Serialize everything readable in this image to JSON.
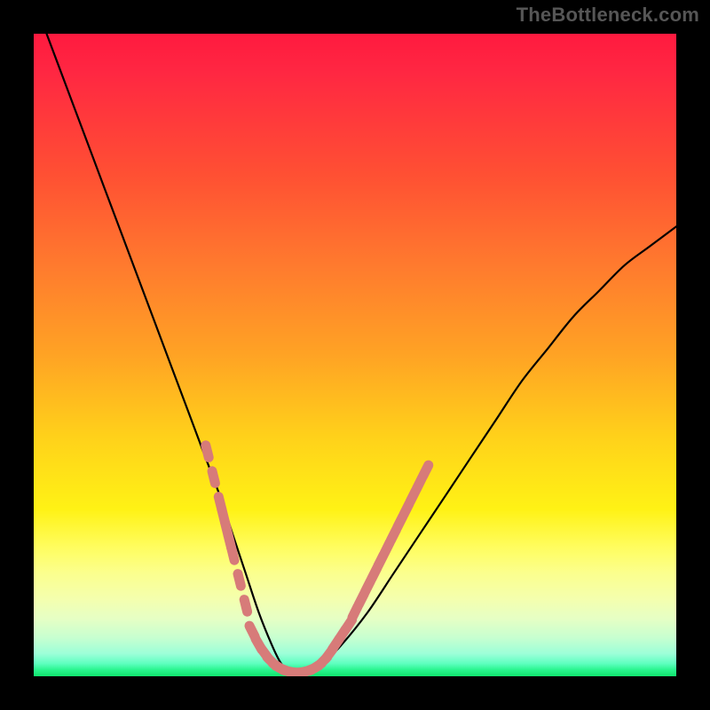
{
  "watermark": "TheBottleneck.com",
  "chart_data": {
    "type": "line",
    "title": "",
    "xlabel": "",
    "ylabel": "",
    "xlim": [
      0,
      100
    ],
    "ylim": [
      0,
      100
    ],
    "series": [
      {
        "name": "main-curve",
        "color": "#000000",
        "x": [
          2,
          5,
          8,
          11,
          14,
          17,
          20,
          23,
          26,
          29,
          31,
          33,
          35,
          37,
          38.5,
          40,
          42,
          45,
          48,
          52,
          56,
          60,
          64,
          68,
          72,
          76,
          80,
          84,
          88,
          92,
          96,
          100
        ],
        "y": [
          100,
          92,
          84,
          76,
          68,
          60,
          52,
          44,
          36,
          28,
          22,
          16,
          10,
          5,
          2,
          0.5,
          0.5,
          2,
          5,
          10,
          16,
          22,
          28,
          34,
          40,
          46,
          51,
          56,
          60,
          64,
          67,
          70
        ]
      },
      {
        "name": "marker-band-left",
        "color": "#d77b79",
        "x": [
          27,
          28,
          29,
          29.5,
          30,
          30.5,
          31,
          32,
          33
        ],
        "y": [
          35,
          31,
          27,
          25,
          23,
          21,
          19,
          15,
          11
        ]
      },
      {
        "name": "marker-band-bottom",
        "color": "#d77b79",
        "x": [
          34,
          35,
          36,
          37,
          38,
          39,
          40,
          41,
          42,
          43,
          44,
          45,
          46,
          47,
          48,
          49
        ],
        "y": [
          7,
          5,
          3.5,
          2.3,
          1.5,
          1,
          0.7,
          0.6,
          0.7,
          1,
          1.5,
          2.3,
          3.5,
          5,
          6.5,
          8
        ]
      },
      {
        "name": "marker-band-right",
        "color": "#d77b79",
        "x": [
          50,
          51,
          52,
          53,
          54,
          55,
          56,
          57,
          58,
          59,
          60,
          61
        ],
        "y": [
          10,
          12,
          14,
          16,
          18,
          20,
          22,
          24,
          26,
          28,
          30,
          32
        ]
      }
    ],
    "gradient_stops": [
      {
        "offset": 0.0,
        "color": "#ff1a3f"
      },
      {
        "offset": 0.22,
        "color": "#ff5033"
      },
      {
        "offset": 0.5,
        "color": "#ffa324"
      },
      {
        "offset": 0.74,
        "color": "#fff215"
      },
      {
        "offset": 0.88,
        "color": "#f4ffae"
      },
      {
        "offset": 0.96,
        "color": "#9cffd8"
      },
      {
        "offset": 1.0,
        "color": "#10e46e"
      }
    ]
  }
}
